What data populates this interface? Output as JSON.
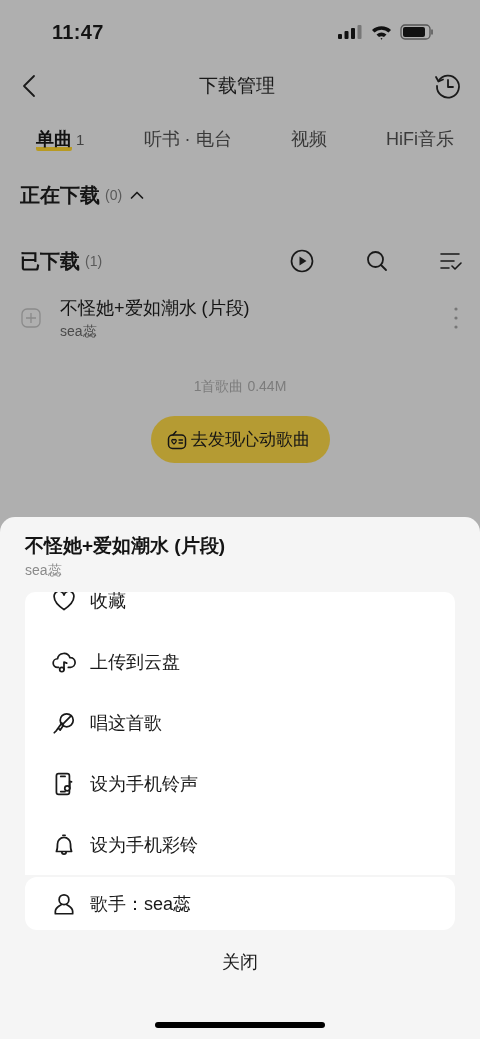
{
  "status_bar": {
    "time": "11:47"
  },
  "nav": {
    "title": "下载管理"
  },
  "tabs": [
    {
      "label": "单曲",
      "count": "1",
      "selected": true
    },
    {
      "label": "听书 · 电台",
      "selected": false
    },
    {
      "label": "视频",
      "selected": false
    },
    {
      "label": "HiFi音乐",
      "selected": false
    }
  ],
  "downloading": {
    "title": "正在下载",
    "count": "(0)",
    "expanded": true
  },
  "downloaded": {
    "title": "已下载",
    "count": "(1)"
  },
  "songs": [
    {
      "title": "不怪她+爱如潮水 (片段)",
      "artist": "sea蕊"
    }
  ],
  "summary": "1首歌曲 0.44M",
  "discover_button": "去发现心动歌曲",
  "sheet": {
    "title": "不怪她+爱如潮水 (片段)",
    "subtitle": "sea蕊",
    "actions": [
      {
        "kind": "heart",
        "label": "收藏"
      },
      {
        "kind": "cloud",
        "label": "上传到云盘"
      },
      {
        "kind": "mic",
        "label": "唱这首歌"
      },
      {
        "kind": "phone",
        "label": "设为手机铃声"
      },
      {
        "kind": "bell",
        "label": "设为手机彩铃"
      }
    ],
    "artist_action": {
      "kind": "person",
      "label": "歌手：sea蕊"
    },
    "close": "关闭"
  }
}
